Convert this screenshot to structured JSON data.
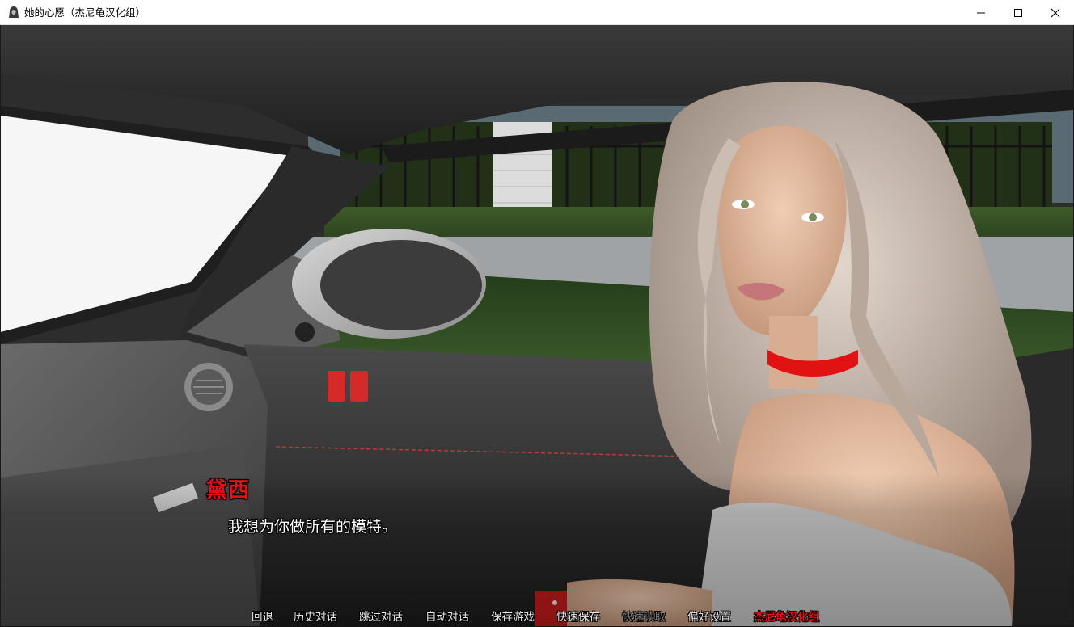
{
  "window": {
    "title": "她的心愿（杰尼龟汉化组）",
    "controls": [
      "minimize",
      "maximize",
      "close"
    ]
  },
  "dialogue": {
    "speaker": "黛西",
    "text": "我想为你做所有的模特。",
    "speaker_color": "#e01212"
  },
  "quick_menu": {
    "items": [
      {
        "label": "回退",
        "state": "enabled"
      },
      {
        "label": "历史对话",
        "state": "enabled"
      },
      {
        "label": "跳过对话",
        "state": "enabled"
      },
      {
        "label": "自动对话",
        "state": "enabled"
      },
      {
        "label": "保存游戏",
        "state": "enabled"
      },
      {
        "label": "快速保存",
        "state": "enabled"
      },
      {
        "label": "快速读取",
        "state": "disabled"
      },
      {
        "label": "偏好设置",
        "state": "enabled"
      },
      {
        "label": "杰尼龟汉化组",
        "state": "accent"
      }
    ]
  },
  "icons": {
    "app": "hooded-figure-icon",
    "minimize": "minimize-icon",
    "maximize": "maximize-icon",
    "close": "close-icon"
  }
}
